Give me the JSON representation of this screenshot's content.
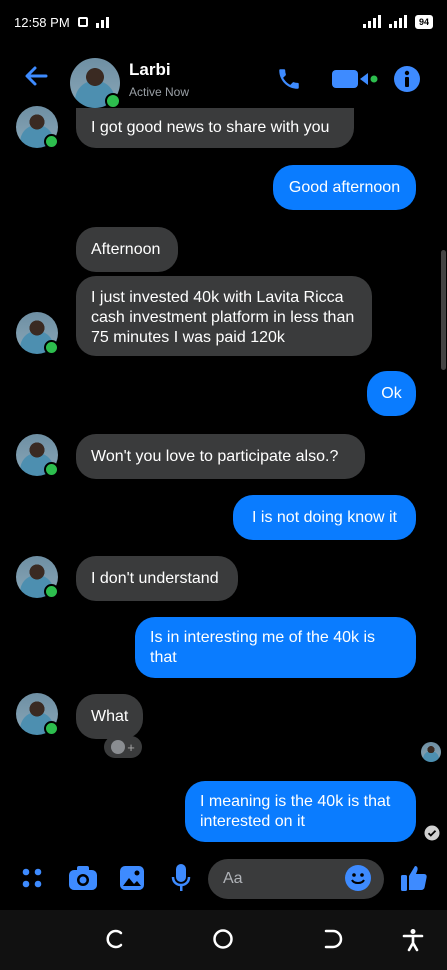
{
  "status_bar": {
    "time": "12:58 PM",
    "battery": "94"
  },
  "header": {
    "name": "Larbi",
    "status": "Active Now"
  },
  "messages": [
    {
      "side": "in",
      "text": "I got good news to share with you"
    },
    {
      "side": "out",
      "text": "Good afternoon"
    },
    {
      "side": "in",
      "text": "Afternoon"
    },
    {
      "side": "in",
      "text": "I just invested 40k with Lavita Ricca cash investment platform in less than 75 minutes I was paid 120k"
    },
    {
      "side": "out",
      "text": "Ok"
    },
    {
      "side": "in",
      "text": "Won't you love to participate also.?"
    },
    {
      "side": "out",
      "text": "I is not doing know it"
    },
    {
      "side": "in",
      "text": "I don't understand"
    },
    {
      "side": "out",
      "text": "Is in interesting me of the 40k is that"
    },
    {
      "side": "in",
      "text": "What"
    },
    {
      "side": "out",
      "text": "I meaning is the 40k is that interested on it"
    }
  ],
  "composer": {
    "placeholder": "Aa"
  },
  "colors": {
    "accent": "#0a7cff",
    "incoming": "#3a3b3c",
    "online": "#2dbe4e"
  },
  "icons": [
    "back-arrow-icon",
    "phone-icon",
    "video-icon",
    "info-icon",
    "menu-dots-icon",
    "camera-icon",
    "gallery-icon",
    "microphone-icon",
    "emoji-icon",
    "thumbs-up-icon",
    "recent-apps-icon",
    "home-icon",
    "back-nav-icon",
    "accessibility-icon",
    "seen-check-icon",
    "add-reaction-icon"
  ]
}
